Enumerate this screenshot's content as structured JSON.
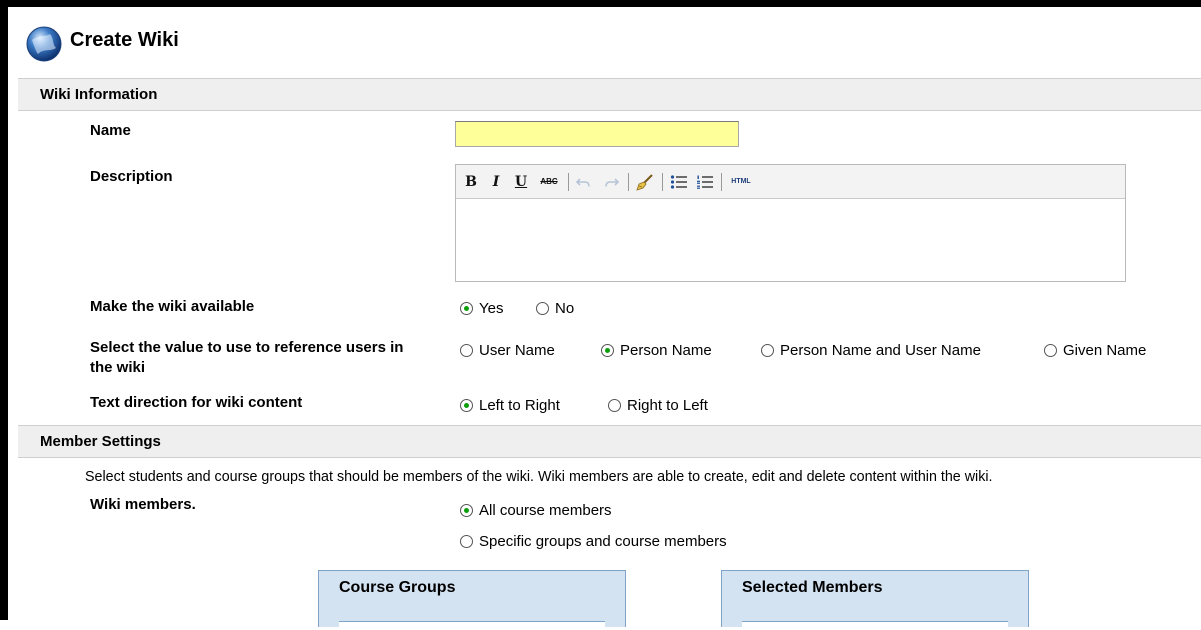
{
  "page": {
    "title": "Create Wiki"
  },
  "sections": {
    "wiki_info": "Wiki Information",
    "member_settings": "Member Settings"
  },
  "fields": {
    "name_label": "Name",
    "name_value": "",
    "description_label": "Description",
    "available_label": "Make the wiki available",
    "reference_label": "Select the value to use to reference users in the wiki",
    "direction_label": "Text direction for wiki content",
    "members_label": "Wiki members."
  },
  "toolbar": {
    "bold": "B",
    "italic": "I",
    "underline": "U",
    "strike": "ABC",
    "html": "HTML"
  },
  "available": {
    "options": [
      "Yes",
      "No"
    ],
    "selected": "Yes"
  },
  "reference": {
    "options": [
      "User Name",
      "Person Name",
      "Person Name and User Name",
      "Given Name"
    ],
    "selected": "Person Name"
  },
  "direction": {
    "options": [
      "Left to Right",
      "Right to Left"
    ],
    "selected": "Left to Right"
  },
  "members": {
    "intro": "Select students and course groups that should be members of the wiki. Wiki members are able to create, edit and delete content within the wiki.",
    "options": [
      "All course members",
      "Specific groups and course members"
    ],
    "selected": "All course members"
  },
  "panels": {
    "course_groups": "Course Groups",
    "selected_members": "Selected Members"
  },
  "colors": {
    "radio_checked": "#0a9f0a",
    "name_input_bg": "#ffff99",
    "panel_bg": "#d4e3f2"
  }
}
